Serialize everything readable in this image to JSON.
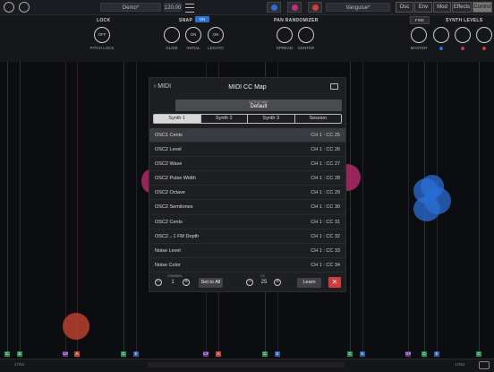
{
  "topbar": {
    "preset": "Demo*",
    "bpm": "120.00",
    "patch": "Vanguise*",
    "tabs": [
      "Osc",
      "Env",
      "Mod",
      "Effects",
      "Control"
    ]
  },
  "controls": {
    "lock": {
      "title": "LOCK",
      "button": "OFF",
      "label": "PITCH LOCK"
    },
    "snap": {
      "title": "SNAP",
      "badge": "ON",
      "knobs": [
        "GLIDE",
        "INITIAL",
        "LEGATO"
      ],
      "initial_value": "ON",
      "legato_value": "ON"
    },
    "pan": {
      "title": "PAN RANDOMIZER",
      "knobs": [
        "SPREAD",
        "CENTER"
      ]
    },
    "levels": {
      "title": "SYNTH LEVELS",
      "fine": "FINE",
      "master": "MASTER"
    }
  },
  "panel": {
    "back_label": "MIDI",
    "title": "MIDI CC Map",
    "active_map_label": "ACTIVE MAP",
    "active_map_value": "Default",
    "tabs": [
      "Synth 1",
      "Synth 2",
      "Synth 3",
      "Session"
    ],
    "rows": [
      {
        "name": "OSC1 Cents",
        "cc": "CH 1 : CC 25"
      },
      {
        "name": "OSC2 Level",
        "cc": "CH 1 : CC 26"
      },
      {
        "name": "OSC2 Wave",
        "cc": "CH 1 : CC 27"
      },
      {
        "name": "OSC2 Pulse Width",
        "cc": "CH 1 : CC 28"
      },
      {
        "name": "OSC2 Octave",
        "cc": "CH 1 : CC 29"
      },
      {
        "name": "OSC2 Semitones",
        "cc": "CH 1 : CC 30"
      },
      {
        "name": "OSC2 Cents",
        "cc": "CH 1 : CC 31"
      },
      {
        "name": "OSC2→1 FM Depth",
        "cc": "CH 1 : CC 32"
      },
      {
        "name": "Noise Level",
        "cc": "CH 1 : CC 33"
      },
      {
        "name": "Noise Color",
        "cc": "CH 1 : CC 34"
      }
    ],
    "footer": {
      "channel_label": "CHANNEL",
      "channel": "1",
      "set_all": "Set to All",
      "cc_label": "CC",
      "cc": "25",
      "learn": "Learn",
      "close": "✕"
    }
  },
  "bottom": {
    "left": "17/64",
    "right": "17/64"
  },
  "colors": {
    "accent_red": "#d33a3a",
    "accent_blue": "#2a6fd6"
  }
}
